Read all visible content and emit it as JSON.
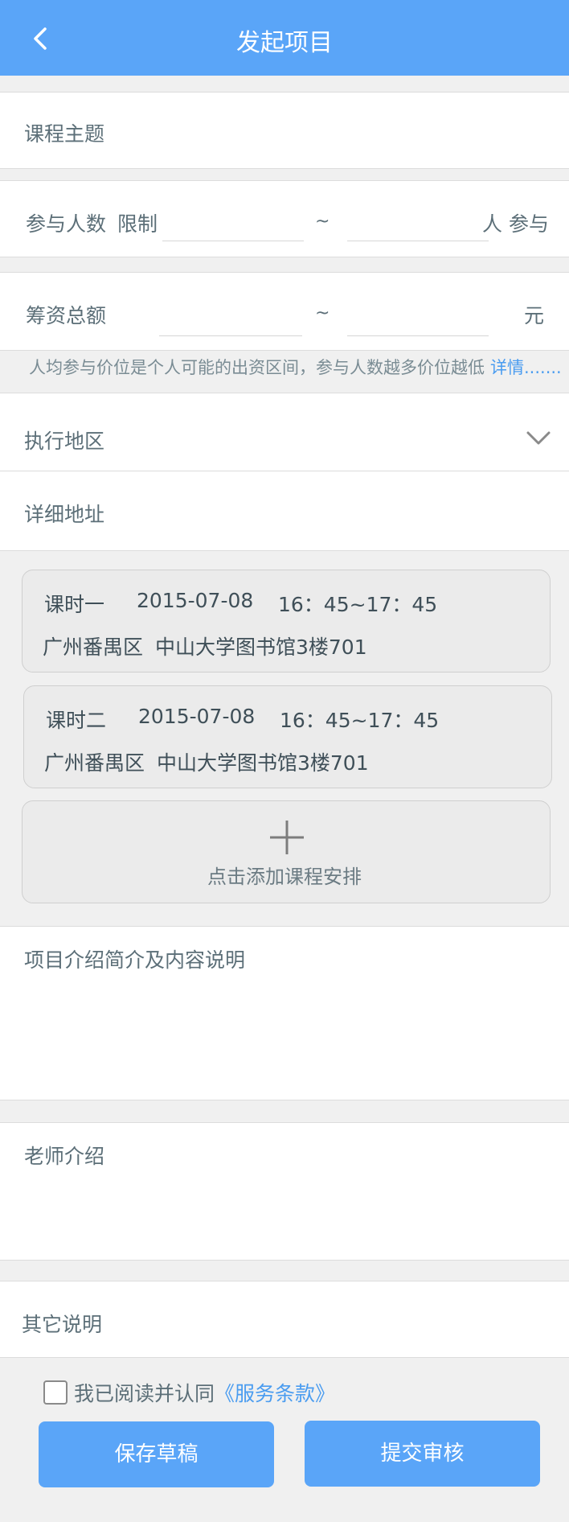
{
  "header": {
    "title": "发起项目"
  },
  "form": {
    "course_topic": "课程主题",
    "participants": {
      "label": "参与人数",
      "limit": "限制",
      "tilde": "~",
      "suffix": "人 参与"
    },
    "funding": {
      "label": "筹资总额",
      "tilde": "~",
      "unit": "元"
    },
    "hint": "人均参与价位是个人可能的出资区间，参与人数越多价位越低",
    "hint_link": "详情.......",
    "region": "执行地区",
    "address": "详细地址"
  },
  "sessions": [
    {
      "name": "课时一",
      "date": "2015-07-08",
      "time": "16：45~17：45",
      "district": "广州番禺区",
      "location": "中山大学图书馆3楼701"
    },
    {
      "name": "课时二",
      "date": "2015-07-08",
      "time": "16：45~17：45",
      "district": "广州番禺区",
      "location": "中山大学图书馆3楼701"
    }
  ],
  "add_session": "点击添加课程安排",
  "project_intro": "项目介绍简介及内容说明",
  "teacher_intro": "老师介绍",
  "other_notes": "其它说明",
  "agreement": {
    "text": "我已阅读并认同",
    "link": "《服务条款》"
  },
  "buttons": {
    "save_draft": "保存草稿",
    "submit": "提交审核"
  },
  "colors": {
    "accent": "#5aa5f8",
    "link": "#4a9cf0"
  },
  "icons": {
    "back": "chevron-left-icon",
    "dropdown": "chevron-down-icon",
    "add": "plus-icon"
  }
}
